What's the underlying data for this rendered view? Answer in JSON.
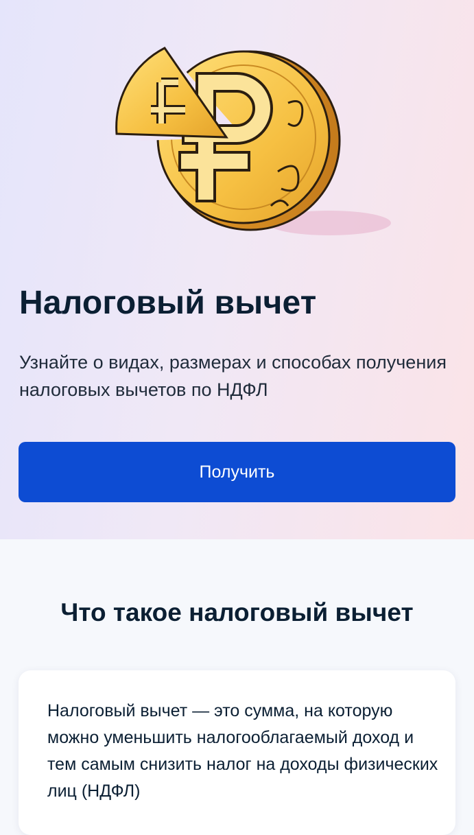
{
  "hero": {
    "illustration": "gold-ruble-coin-with-cut-slice",
    "title": "Налоговый вычет",
    "subtitle": "Узнайте о видах, размерах и способах получения налоговых вычетов по НДФЛ",
    "button_label": "Получить"
  },
  "info_section": {
    "title": "Что такое налоговый вычет",
    "card_text": "Налоговый вычет — это сумма, на которую можно уменьшить налогооблагаемый доход и тем самым снизить налог на доходы физических лиц (НДФЛ)"
  },
  "colors": {
    "primary": "#0d4cd3",
    "text": "#0b1f33",
    "coin_gold": "#f7c64a"
  }
}
